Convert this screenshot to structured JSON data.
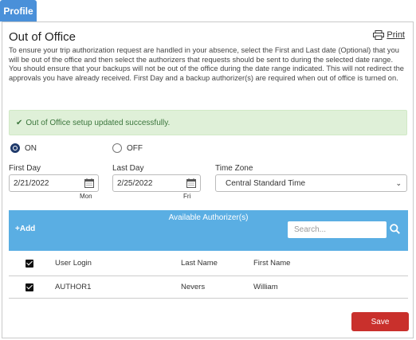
{
  "tab": {
    "label": "Profile"
  },
  "header": {
    "title": "Out of Office",
    "print_label": "Print"
  },
  "description": "To ensure your trip authorization request are handled in your absence, select the First and Last date (Optional) that you will be out of the office and then select the authorizers that requests should be sent to during the selected date range. You should ensure that your backups will not be out of the office during the date range indicated. This will not redirect the approvals you have already received. First Day and a backup authorizer(s) are required when out of office is turned on.",
  "alert": {
    "message": "Out of Office setup updated successfully."
  },
  "status": {
    "on_label": "ON",
    "off_label": "OFF",
    "selected": "ON"
  },
  "first_day": {
    "label": "First Day",
    "value": "2/21/2022",
    "weekday": "Mon"
  },
  "last_day": {
    "label": "Last Day",
    "value": "2/25/2022",
    "weekday": "Fri"
  },
  "time_zone": {
    "label": "Time Zone",
    "value": "Central Standard Time"
  },
  "authorizers": {
    "title": "Available Authorizer(s)",
    "add_label": "Add",
    "search_placeholder": "Search...",
    "columns": [
      "User Login",
      "Last Name",
      "First Name"
    ],
    "rows": [
      {
        "login": "AUTHOR1",
        "last": "Nevers",
        "first": "William",
        "checked": true
      }
    ]
  },
  "save_label": "Save",
  "colors": {
    "tab": "#4a90d9",
    "table_header": "#5aaee3",
    "alert_bg": "#dff0d8",
    "save": "#c9302c"
  },
  "icons": [
    "print-icon",
    "calendar-icon",
    "checkmark-icon",
    "plus-icon",
    "search-icon",
    "chevron-down-icon"
  ]
}
